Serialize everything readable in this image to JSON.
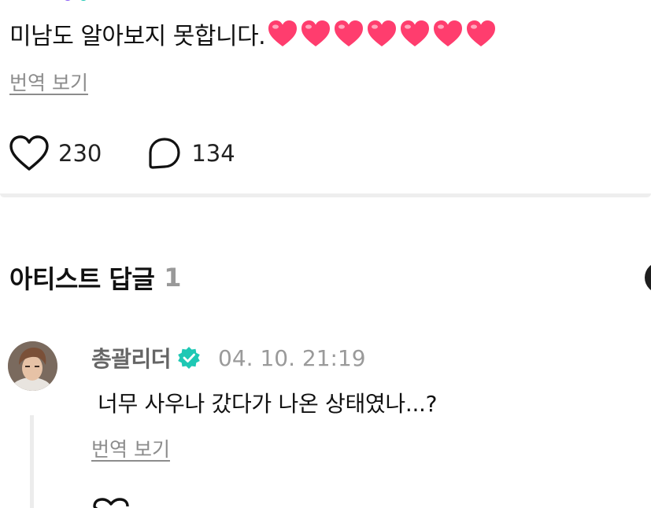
{
  "post": {
    "text": "미남도 알아보지 못합니다.",
    "hearts": [
      "heart",
      "heart",
      "heart",
      "heart",
      "heart",
      "heart",
      "heart"
    ],
    "heart_color": "#ff3d6e",
    "translate_label": "번역 보기",
    "likes": "230",
    "comments": "134"
  },
  "artist_replies": {
    "title": "아티스트 답글",
    "count": "1",
    "comment": {
      "author": "총괄리더",
      "time": "04. 10. 21:19",
      "text": "너무 사우나 갔다가 나온 상태였나...?",
      "translate_label": "번역 보기",
      "verified_color": "#1ec8b4"
    }
  },
  "colors": {
    "text": "#111111",
    "muted": "#8c8c8c",
    "divider": "#eeeeee"
  }
}
